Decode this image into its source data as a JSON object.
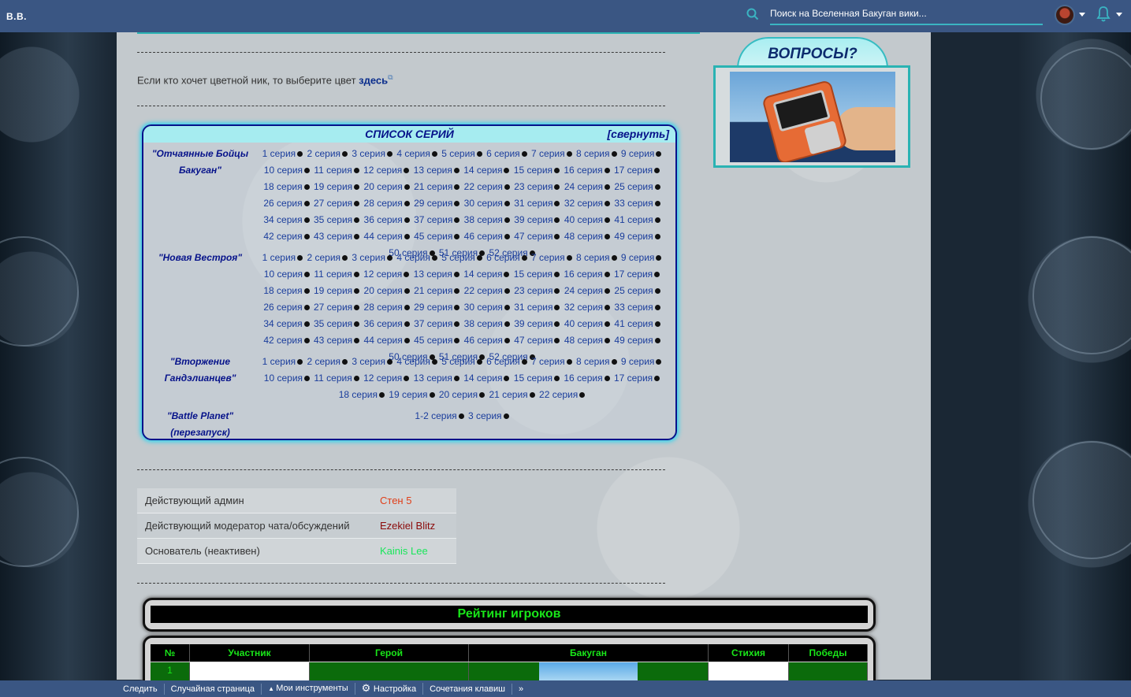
{
  "topbar": {
    "logo": "B.B.",
    "search_placeholder": "Поиск на Вселенная Бакуган вики..."
  },
  "intro": {
    "nick_text": "Если кто хочет цветной ник, то выберите цвет ",
    "nick_link": "здесь"
  },
  "series": {
    "title": "СПИСОК СЕРИЙ",
    "collapse": "[свернуть]",
    "seasons": [
      {
        "title_line1": "\"Отчаянные Бойцы",
        "title_line2": "Бакуган\"",
        "episodes": [
          "1 серия",
          "2 серия",
          "3 серия",
          "4 серия",
          "5 серия",
          "6 серия",
          "7 серия",
          "8 серия",
          "9 серия",
          "10 серия",
          "11 серия",
          "12 серия",
          "13 серия",
          "14 серия",
          "15 серия",
          "16 серия",
          "17 серия",
          "18 серия",
          "19 серия",
          "20 серия",
          "21 серия",
          "22 серия",
          "23 серия",
          "24 серия",
          "25 серия",
          "26 серия",
          "27 серия",
          "28 серия",
          "29 серия",
          "30 серия",
          "31 серия",
          "32 серия",
          "33 серия",
          "34 серия",
          "35 серия",
          "36 серия",
          "37 серия",
          "38 серия",
          "39 серия",
          "40 серия",
          "41 серия",
          "42 серия",
          "43 серия",
          "44 серия",
          "45 серия",
          "46 серия",
          "47 серия",
          "48 серия",
          "49 серия",
          "50 серия",
          "51 серия",
          "52 серия"
        ]
      },
      {
        "title_line1": "\"Новая Вестроя\"",
        "title_line2": "",
        "episodes": [
          "1 серия",
          "2 серия",
          "3 серия",
          "4 серия",
          "5 серия",
          "6 серия",
          "7 серия",
          "8 серия",
          "9 серия",
          "10 серия",
          "11 серия",
          "12 серия",
          "13 серия",
          "14 серия",
          "15 серия",
          "16 серия",
          "17 серия",
          "18 серия",
          "19 серия",
          "20 серия",
          "21 серия",
          "22 серия",
          "23 серия",
          "24 серия",
          "25 серия",
          "26 серия",
          "27 серия",
          "28 серия",
          "29 серия",
          "30 серия",
          "31 серия",
          "32 серия",
          "33 серия",
          "34 серия",
          "35 серия",
          "36 серия",
          "37 серия",
          "38 серия",
          "39 серия",
          "40 серия",
          "41 серия",
          "42 серия",
          "43 серия",
          "44 серия",
          "45 серия",
          "46 серия",
          "47 серия",
          "48 серия",
          "49 серия",
          "50 серия",
          "51 серия",
          "52 серия"
        ]
      },
      {
        "title_line1": "\"Вторжение",
        "title_line2": "Гандэлианцев\"",
        "episodes": [
          "1 серия",
          "2 серия",
          "3 серия",
          "4 серия",
          "5 серия",
          "6 серия",
          "7 серия",
          "8 серия",
          "9 серия",
          "10 серия",
          "11 серия",
          "12 серия",
          "13 серия",
          "14 серия",
          "15 серия",
          "16 серия",
          "17 серия",
          "18 серия",
          "19 серия",
          "20 серия",
          "21 серия",
          "22 серия"
        ]
      },
      {
        "title_line1": "\"Battle Planet\"",
        "title_line2": "(перезапуск)",
        "episodes": [
          "1-2 серия",
          "3 серия"
        ]
      }
    ]
  },
  "staff": [
    {
      "role": "Действующий админ",
      "name": "Стен 5",
      "color": "#e0401a"
    },
    {
      "role": "Действующий модератор чата/обсуждений",
      "name": "Ezekiel Blitz",
      "color": "#8b0a0a"
    },
    {
      "role": "Основатель (неактивен)",
      "name": "Kainis Lee",
      "color": "#19e65a"
    }
  ],
  "rating": {
    "title": "Рейтинг игроков",
    "headers": [
      "№",
      "Участник",
      "Герой",
      "Бакуган",
      "Стихия",
      "Победы"
    ],
    "first_row_num": "1"
  },
  "sidebar": {
    "questions_title": "ВОПРОСЫ?"
  },
  "toolbar": {
    "items": [
      "Следить",
      "Случайная страница",
      "Мои инструменты",
      "Настройка",
      "Сочетания клавиш",
      "»"
    ]
  }
}
